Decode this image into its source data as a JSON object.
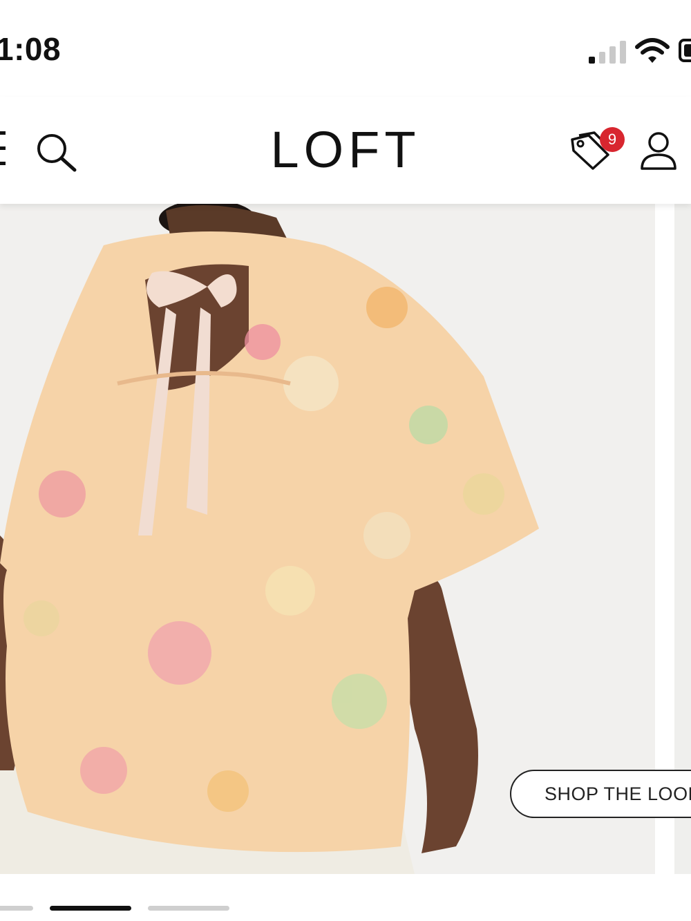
{
  "status_bar": {
    "time": "1:08"
  },
  "header": {
    "brand": "LOFT",
    "offers_count": "9"
  },
  "hero": {
    "cta_label": "SHOP THE LOOK"
  },
  "carousel": {
    "active_index": 1,
    "count": 3
  },
  "colors": {
    "badge": "#d8262f",
    "text": "#111111",
    "image_bg": "#f1f0ee"
  }
}
